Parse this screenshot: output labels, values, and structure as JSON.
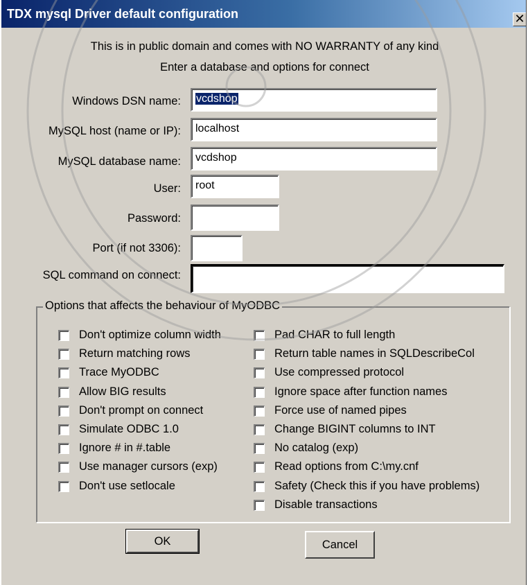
{
  "window": {
    "title": "TDX mysql Driver default configuration",
    "close_glyph": "✕"
  },
  "info": {
    "line1": "This is in public domain and comes with NO WARRANTY of any kind",
    "line2": "Enter a database and options for connect"
  },
  "fields": {
    "dsn": {
      "label": "Windows DSN name:",
      "value": "vcdshop"
    },
    "host": {
      "label": "MySQL host (name or IP):",
      "value": "localhost"
    },
    "database": {
      "label": "MySQL database name:",
      "value": "vcdshop"
    },
    "user": {
      "label": "User:",
      "value": "root"
    },
    "password": {
      "label": "Password:",
      "value": ""
    },
    "port": {
      "label": "Port (if not 3306):",
      "value": ""
    },
    "sql": {
      "label": "SQL command on connect:",
      "value": ""
    }
  },
  "options": {
    "legend": "Options that affects the behaviour of MyODBC",
    "left": [
      {
        "label": "Don't optimize column width",
        "checked": false
      },
      {
        "label": "Return matching rows",
        "checked": false
      },
      {
        "label": "Trace MyODBC",
        "checked": false
      },
      {
        "label": "Allow BIG results",
        "checked": false
      },
      {
        "label": "Don't prompt on connect",
        "checked": false
      },
      {
        "label": "Simulate ODBC 1.0",
        "checked": false
      },
      {
        "label": "Ignore # in #.table",
        "checked": false
      },
      {
        "label": "Use manager cursors (exp)",
        "checked": false
      },
      {
        "label": "Don't use setlocale",
        "checked": false
      }
    ],
    "right": [
      {
        "label": "Pad CHAR to full length",
        "checked": false
      },
      {
        "label": "Return table names in SQLDescribeCol",
        "checked": false
      },
      {
        "label": "Use compressed protocol",
        "checked": false
      },
      {
        "label": "Ignore space after function names",
        "checked": false
      },
      {
        "label": "Force use of named pipes",
        "checked": false
      },
      {
        "label": "Change BIGINT columns to INT",
        "checked": false
      },
      {
        "label": "No catalog (exp)",
        "checked": false
      },
      {
        "label": "Read options from C:\\my.cnf",
        "checked": false
      },
      {
        "label": "Safety (Check this if you have problems)",
        "checked": false
      },
      {
        "label": "Disable transactions",
        "checked": false
      }
    ]
  },
  "buttons": {
    "ok": "OK",
    "cancel": "Cancel"
  },
  "colors": {
    "dialog_bg": "#d4d0c8",
    "titlebar_start": "#0a246a",
    "titlebar_end": "#a6caf0",
    "selection": "#0a246a"
  }
}
